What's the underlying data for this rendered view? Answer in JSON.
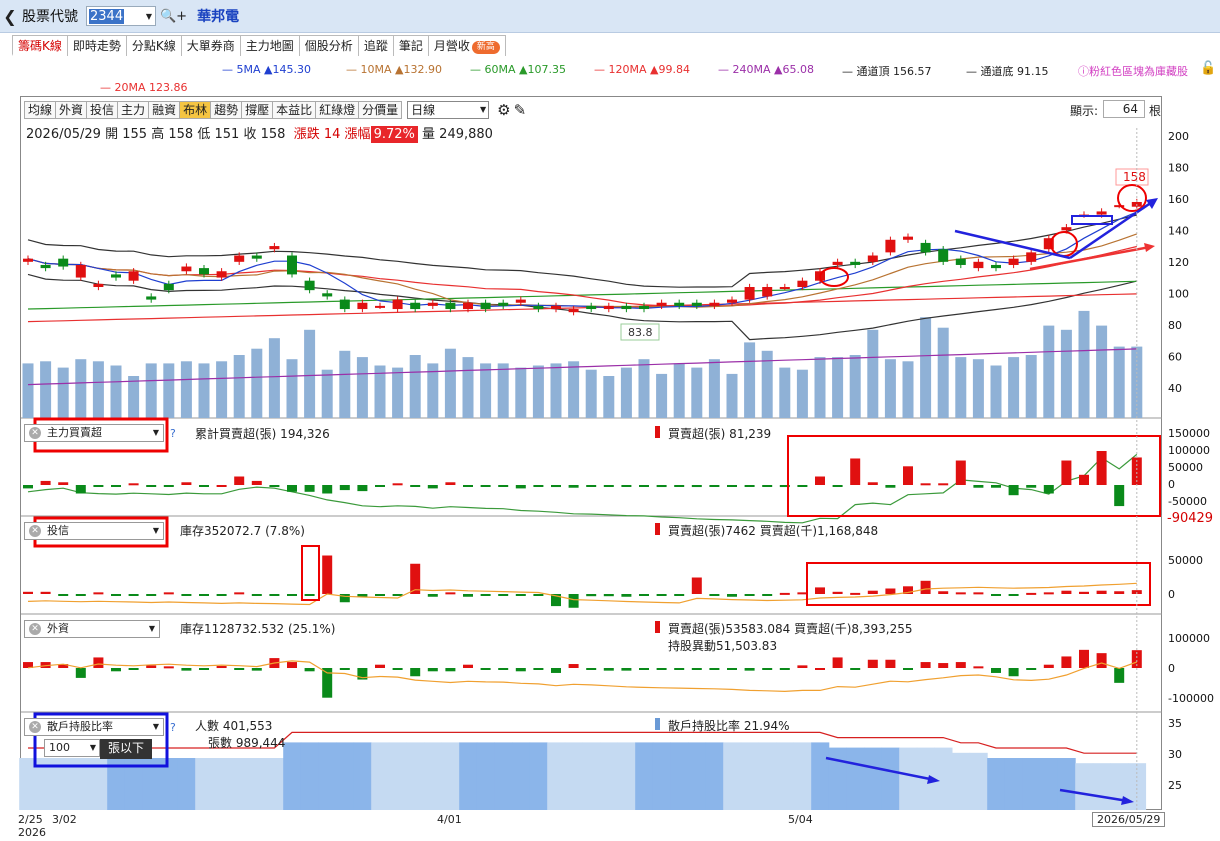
{
  "header": {
    "back": "❮",
    "code_label": "股票代號",
    "code": "2344",
    "name": "華邦電"
  },
  "tabs": [
    {
      "label": "籌碼K線",
      "active": true
    },
    {
      "label": "即時走勢"
    },
    {
      "label": "分點K線"
    },
    {
      "label": "大單券商"
    },
    {
      "label": "主力地圖"
    },
    {
      "label": "個股分析"
    },
    {
      "label": "追蹤"
    },
    {
      "label": "筆記"
    },
    {
      "label": "月營收",
      "badge": "新高"
    }
  ],
  "ma_legend": [
    "5MA ▲145.30",
    "10MA ▲132.90",
    "60MA ▲107.35",
    "120MA ▲99.84",
    "240MA ▲65.08",
    "通道頂 156.57",
    "通道底 91.15",
    "20MA 123.86"
  ],
  "ma_colors": {
    "5MA": "#1f3fd0",
    "10MA": "#b87332",
    "60MA": "#2a9a2a",
    "120MA": "#e83030",
    "240MA": "#9b2fa8",
    "top": "#222",
    "bottom": "#222",
    "20MA": "#e83030"
  },
  "hint": "ⓘ粉紅色區塊為庫藏股",
  "toolbar": {
    "buttons": [
      "均線",
      "外資",
      "投信",
      "主力",
      "融資",
      "布林",
      "趨勢",
      "撐壓",
      "本益比",
      "紅綠燈",
      "分價量"
    ],
    "active": "布林",
    "period": "日線",
    "show_label": "顯示:",
    "show_count": "64",
    "show_unit": "根"
  },
  "ohlc": {
    "date": "2026/05/29",
    "open_l": "開",
    "open": "155",
    "high_l": "高",
    "high": "158",
    "low_l": "低",
    "low": "151",
    "close_l": "收",
    "close": "158",
    "chg_l": "漲跌",
    "chg": "14",
    "pct_l": "漲幅",
    "pct": "9.72%",
    "vol_l": "量",
    "vol": "249,880"
  },
  "price_axis": [
    "200",
    "180",
    "160",
    "140",
    "120",
    "100",
    "80",
    "60",
    "40"
  ],
  "annotations": {
    "low_price": "83.8",
    "high_price": "158"
  },
  "panels": {
    "main_force": {
      "select": "主力買賣超",
      "cum": "累計買賣超(張) 194,326",
      "net": "買賣超(張) 81,239",
      "axis": [
        "150000",
        "100000",
        "50000",
        "0",
        "-50000"
      ],
      "edge": "-90429"
    },
    "invest": {
      "select": "投信",
      "inv": "庫存352072.7 (7.8%)",
      "net": "買賣超(張)7462 買賣超(千)1,168,848",
      "axis": [
        "50000",
        "0"
      ]
    },
    "foreign": {
      "select": "外資",
      "inv": "庫存1128732.532 (25.1%)",
      "net": "買賣超(張)53583.084 買賣超(千)8,393,255",
      "hold": "持股異動51,503.83",
      "axis": [
        "100000",
        "0",
        "-100000"
      ]
    },
    "retail": {
      "select": "散戶持股比率",
      "sub_value": "100",
      "sub_unit": "張以下",
      "people": "人數 401,553",
      "shares": "張數 989,444",
      "ratio": "散戶持股比率 21.94%",
      "axis": [
        "35",
        "30",
        "25"
      ]
    }
  },
  "x_axis": [
    "2/25",
    "3/02",
    "4/01",
    "5/04"
  ],
  "x_year": "2026",
  "last_date": "2026/05/29",
  "chart_data": {
    "type": "candlestick",
    "ylim": [
      30,
      205
    ],
    "open": [
      120,
      118,
      122,
      110,
      104,
      112,
      108,
      98,
      106,
      114,
      116,
      110,
      120,
      124,
      128,
      124,
      108,
      100,
      96,
      90,
      92,
      90,
      94,
      92,
      94,
      90,
      94,
      94,
      94,
      92,
      90,
      88,
      92,
      90,
      92,
      92,
      92,
      94,
      94,
      92,
      94,
      96,
      98,
      104,
      104,
      108,
      118,
      120,
      120,
      126,
      134,
      132,
      128,
      122,
      116,
      118,
      118,
      120,
      128,
      140,
      150,
      150,
      156,
      155
    ],
    "close": [
      122,
      116,
      117,
      118,
      106,
      110,
      114,
      96,
      102,
      117,
      112,
      114,
      124,
      122,
      130,
      112,
      102,
      98,
      90,
      94,
      92,
      96,
      90,
      94,
      90,
      94,
      90,
      92,
      96,
      90,
      92,
      90,
      90,
      92,
      90,
      90,
      94,
      92,
      92,
      94,
      96,
      104,
      104,
      104,
      108,
      114,
      120,
      118,
      124,
      134,
      136,
      126,
      120,
      118,
      120,
      116,
      122,
      126,
      135,
      142,
      150,
      152,
      156,
      158
    ],
    "volume": [
      52,
      54,
      48,
      56,
      54,
      50,
      40,
      52,
      52,
      54,
      52,
      54,
      60,
      66,
      76,
      56,
      84,
      46,
      64,
      58,
      50,
      48,
      60,
      52,
      66,
      58,
      52,
      52,
      48,
      50,
      52,
      54,
      46,
      40,
      48,
      56,
      42,
      52,
      48,
      56,
      42,
      72,
      64,
      48,
      46,
      58,
      58,
      60,
      84,
      56,
      54,
      96,
      86,
      58,
      56,
      50,
      58,
      60,
      88,
      84,
      102,
      88,
      68,
      68
    ],
    "main_force": [
      -10,
      12,
      8,
      -25,
      -5,
      -3,
      5,
      -3,
      -4,
      8,
      -4,
      0,
      25,
      12,
      -6,
      -20,
      -20,
      -25,
      -15,
      -18,
      -5,
      5,
      -3,
      -10,
      8,
      -4,
      -5,
      -2,
      -10,
      -4,
      -6,
      -8,
      -2,
      -4,
      -4,
      -2,
      -6,
      -4,
      -6,
      -4,
      -2,
      -4,
      -4,
      -6,
      -2,
      25,
      -2,
      78,
      8,
      -8,
      55,
      5,
      5,
      72,
      -8,
      -8,
      -30,
      -8,
      -25,
      72,
      30,
      100,
      -62,
      81
    ],
    "invest": [
      4,
      4,
      -3,
      -3,
      3,
      -3,
      -2,
      -3,
      3,
      -3,
      -3,
      -3,
      3,
      -3,
      -2,
      -3,
      -3,
      70,
      -15,
      -5,
      -3,
      -3,
      55,
      -5,
      3,
      -5,
      -3,
      -3,
      -3,
      -3,
      -22,
      -25,
      -4,
      -4,
      -5,
      -3,
      -3,
      -3,
      30,
      -3,
      -5,
      -3,
      -3,
      2,
      3,
      12,
      4,
      2,
      6,
      10,
      14,
      24,
      5,
      3,
      3,
      -3,
      -3,
      2,
      3,
      6,
      4,
      6,
      5,
      7
    ],
    "foreign": [
      18,
      18,
      12,
      -30,
      32,
      -10,
      -5,
      8,
      5,
      -8,
      -5,
      6,
      -5,
      -8,
      30,
      18,
      -10,
      -90,
      -5,
      -35,
      10,
      -5,
      -25,
      -10,
      -10,
      10,
      -5,
      -2,
      -10,
      -5,
      -15,
      12,
      -5,
      -8,
      -8,
      -5,
      -3,
      -3,
      -3,
      -3,
      -5,
      -8,
      -3,
      -5,
      8,
      0,
      32,
      -5,
      25,
      25,
      -5,
      18,
      15,
      18,
      5,
      -15,
      -25,
      -5,
      10,
      35,
      55,
      45,
      -45,
      54
    ],
    "retail_ratio": [
      31,
      31,
      31,
      31,
      31,
      31,
      31,
      31,
      31,
      31,
      31,
      31,
      31,
      31,
      31,
      34,
      34,
      34,
      34,
      34,
      34,
      34,
      34,
      34,
      34,
      34,
      34,
      34,
      34,
      34,
      34,
      34,
      34,
      34,
      34,
      34,
      34,
      34,
      34,
      34,
      34,
      34,
      34,
      34,
      34,
      34,
      33,
      33,
      33,
      33,
      33,
      33,
      33,
      32,
      32,
      31,
      31,
      31,
      31,
      31,
      30,
      30,
      30,
      30
    ]
  }
}
